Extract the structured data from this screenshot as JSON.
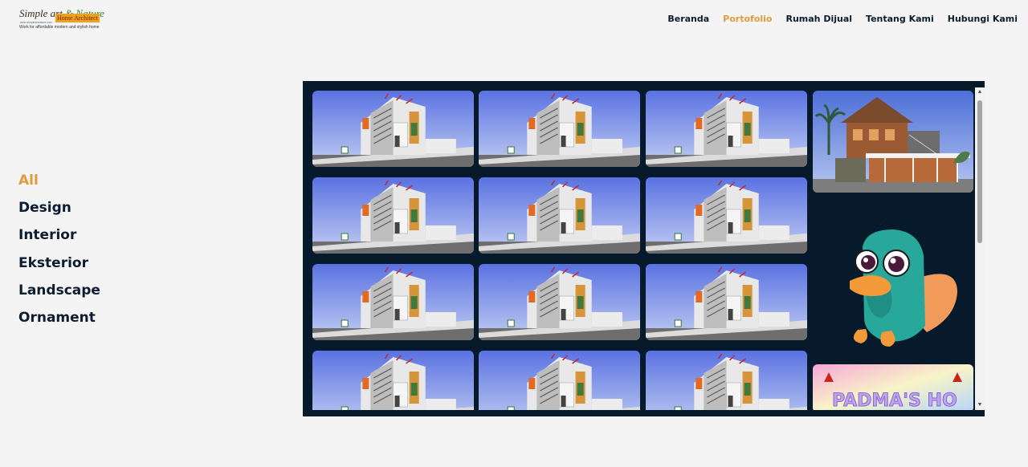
{
  "logo": {
    "script_start": "Simple art",
    "script_amp": "& Nature",
    "box_text": "Home Architect",
    "url": "www.simpleartnature.com",
    "tagline": "Work for affordable modern and stylish home"
  },
  "nav": {
    "items": [
      {
        "label": "Beranda",
        "active": false
      },
      {
        "label": "Portofolio",
        "active": true
      },
      {
        "label": "Rumah Dijual",
        "active": false
      },
      {
        "label": "Tentang Kami",
        "active": false
      },
      {
        "label": "Hubungi Kami",
        "active": false
      }
    ]
  },
  "filters": {
    "items": [
      {
        "label": "All",
        "active": true
      },
      {
        "label": "Design",
        "active": false
      },
      {
        "label": "Interior",
        "active": false
      },
      {
        "label": "Eksterior",
        "active": false
      },
      {
        "label": "Landscape",
        "active": false
      },
      {
        "label": "Ornament",
        "active": false
      }
    ]
  },
  "gallery": {
    "thumbnails": [
      {
        "kind": "house-render"
      },
      {
        "kind": "house-render"
      },
      {
        "kind": "house-render"
      },
      {
        "kind": "house-render"
      },
      {
        "kind": "house-render"
      },
      {
        "kind": "house-render"
      },
      {
        "kind": "house-render"
      },
      {
        "kind": "house-render"
      },
      {
        "kind": "house-render"
      },
      {
        "kind": "house-render"
      },
      {
        "kind": "house-render"
      },
      {
        "kind": "house-render"
      }
    ],
    "side": {
      "house_photo": "wooden-house-render",
      "mascot": "platypus-cartoon",
      "banner_text": "PADMA'S HO"
    },
    "scroll": {
      "up_icon": "▲",
      "down_icon": "▼"
    }
  },
  "colors": {
    "accent": "#e39a3c",
    "text_dark": "#0d1c2e",
    "gallery_bg": "#061a2b",
    "page_bg": "#f4f4f4"
  }
}
